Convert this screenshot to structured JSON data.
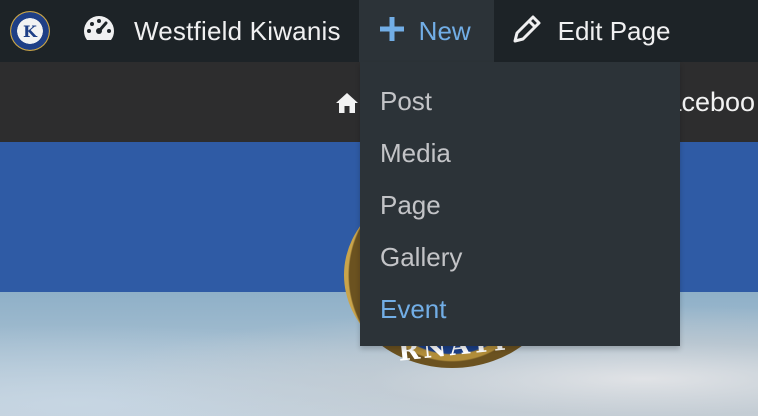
{
  "adminbar": {
    "logo_icon": "kiwanis-logo",
    "logo_letter": "K",
    "site_icon": "dashboard-gauge-icon",
    "site_name": "Westfield Kiwanis",
    "new_icon": "plus-icon",
    "new_label": "New",
    "edit_icon": "pencil-icon",
    "edit_label": "Edit Page"
  },
  "new_menu": {
    "items": [
      {
        "label": "Post"
      },
      {
        "label": "Media"
      },
      {
        "label": "Page"
      },
      {
        "label": "Gallery"
      },
      {
        "label": "Event",
        "highlighted": true
      }
    ]
  },
  "site_nav": {
    "home_icon": "home-icon",
    "facebook_partial": "Faceboo"
  },
  "emblem": {
    "partial_text": "RNATI"
  },
  "colors": {
    "adminbar_bg": "#1d2327",
    "dropdown_bg": "#2c3338",
    "accent_blue": "#72aee6",
    "header_blue": "#2f5ba5",
    "nav_bg": "#2d2d2e"
  }
}
